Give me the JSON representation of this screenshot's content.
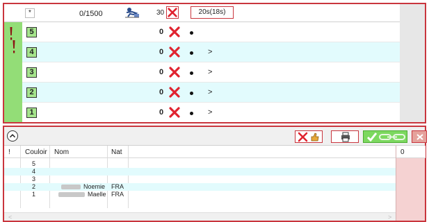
{
  "top_panel": {
    "header": {
      "star": "*",
      "counter": "0/1500",
      "count_value": "30",
      "timer": "20s(18s)"
    },
    "lanes": [
      {
        "number": "5",
        "score": "0",
        "arrow": ""
      },
      {
        "number": "4",
        "score": "0",
        "arrow": ">"
      },
      {
        "number": "3",
        "score": "0",
        "arrow": ">"
      },
      {
        "number": "2",
        "score": "0",
        "arrow": ">"
      },
      {
        "number": "1",
        "score": "0",
        "arrow": ">"
      }
    ]
  },
  "bottom_panel": {
    "table": {
      "columns": [
        "!",
        "Couloir",
        "Nom",
        "Nat"
      ],
      "rows": [
        {
          "flag": "",
          "couloir": "5",
          "nom": "",
          "nat": ""
        },
        {
          "flag": "",
          "couloir": "4",
          "nom": "",
          "nat": ""
        },
        {
          "flag": "",
          "couloir": "3",
          "nom": "",
          "nat": ""
        },
        {
          "flag": "",
          "couloir": "2",
          "nom": "Noemie",
          "nat": "FRA"
        },
        {
          "flag": "",
          "couloir": "1",
          "nom": "Maelle",
          "nat": "FRA"
        }
      ]
    },
    "side_header": "0",
    "scroll_left": "<",
    "scroll_right": ">"
  },
  "colors": {
    "border_red": "#c9353d",
    "lane_green": "#93dd77",
    "lane_cyan": "#e2fbfd",
    "side_pink": "#f5d2d2"
  },
  "icons": [
    "exclamation-icon",
    "runner-icon",
    "red-x-icon",
    "thumbs-up-icon",
    "printer-icon",
    "checkmark-icon",
    "chain-link-icon",
    "close-icon",
    "chevron-up-icon"
  ]
}
